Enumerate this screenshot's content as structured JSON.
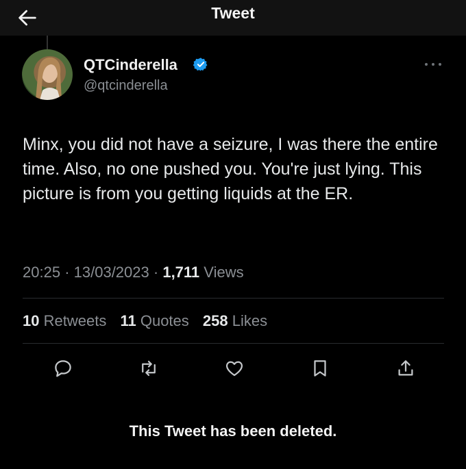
{
  "header": {
    "title": "Tweet",
    "back_icon": "arrow-left-icon"
  },
  "author": {
    "display_name": "QTCinderella",
    "handle": "@qtcinderella",
    "verified": true,
    "verified_color": "#1d9bf0"
  },
  "tweet": {
    "text": "Minx, you did not have a seizure, I was there the entire time. Also, no one pushed you. You're just lying. This picture is from you getting liquids at the ER.",
    "time": "20:25",
    "separator": "·",
    "date": "13/03/2023",
    "views_count": "1,711",
    "views_label": "Views"
  },
  "stats": {
    "retweets_count": "10",
    "retweets_label": "Retweets",
    "quotes_count": "11",
    "quotes_label": "Quotes",
    "likes_count": "258",
    "likes_label": "Likes"
  },
  "actions": [
    {
      "icon": "reply-icon"
    },
    {
      "icon": "retweet-icon"
    },
    {
      "icon": "heart-icon"
    },
    {
      "icon": "bookmark-icon"
    },
    {
      "icon": "share-icon"
    }
  ],
  "notice": "This Tweet has been deleted.",
  "colors": {
    "background": "#000000",
    "topbar": "#121212",
    "text": "#e7e9ea",
    "muted": "#8b8f94",
    "divider": "#2a2d30"
  }
}
